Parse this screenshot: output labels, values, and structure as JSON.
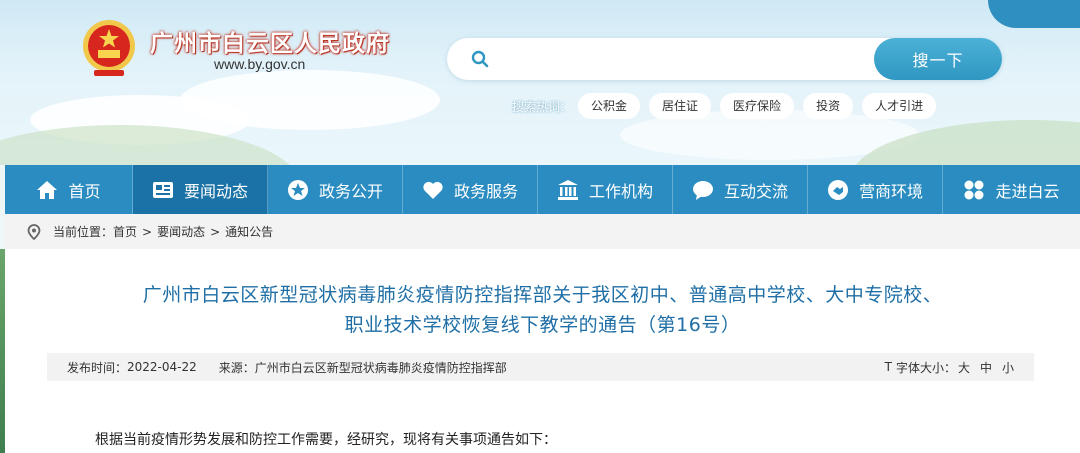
{
  "site": {
    "title": "广州市白云区人民政府",
    "url": "www.by.gov.cn"
  },
  "search": {
    "placeholder": "",
    "button_label": "搜一下",
    "hot_label": "搜索热词：",
    "hot_words": [
      "公积金",
      "居住证",
      "医疗保险",
      "投资",
      "人才引进"
    ]
  },
  "nav": {
    "items": [
      {
        "label": "首页",
        "icon": "home-icon"
      },
      {
        "label": "要闻动态",
        "icon": "news-icon",
        "active": true
      },
      {
        "label": "政务公开",
        "icon": "star-icon"
      },
      {
        "label": "政务服务",
        "icon": "heart-icon"
      },
      {
        "label": "工作机构",
        "icon": "building-icon"
      },
      {
        "label": "互动交流",
        "icon": "chat-icon"
      },
      {
        "label": "营商环境",
        "icon": "handshake-icon"
      },
      {
        "label": "走进白云",
        "icon": "grid-icon"
      }
    ]
  },
  "breadcrumb": {
    "label": "当前位置：",
    "items": [
      "首页",
      "要闻动态",
      "通知公告"
    ],
    "separator": ">"
  },
  "article": {
    "title_line1": "广州市白云区新型冠状病毒肺炎疫情防控指挥部关于我区初中、普通高中学校、大中专院校、",
    "title_line2": "职业技术学校恢复线下教学的通告（第16号）",
    "publish_label": "发布时间：",
    "publish_date": "2022-04-22",
    "source_label": "来源：",
    "source": "广州市白云区新型冠状病毒肺炎疫情防控指挥部",
    "font_size_glyph": "T",
    "font_size_label": "字体大小：",
    "font_sizes": [
      "大",
      "中",
      "小"
    ],
    "body_first_line": "根据当前疫情形势发展和防控工作需要，经研究，现将有关事项通告如下："
  },
  "colors": {
    "nav_bg": "#2a8cc0",
    "nav_active": "#1a72a6",
    "title_blue": "#1f6fa6",
    "search_button": "#2f97c2"
  }
}
